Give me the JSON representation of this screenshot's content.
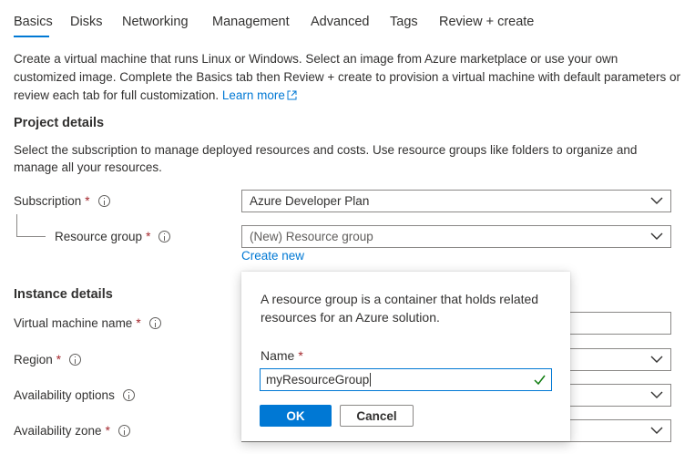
{
  "tabs": [
    {
      "label": "Basics"
    },
    {
      "label": "Disks"
    },
    {
      "label": "Networking"
    },
    {
      "label": "Management"
    },
    {
      "label": "Advanced"
    },
    {
      "label": "Tags"
    },
    {
      "label": "Review + create"
    }
  ],
  "intro": {
    "text": "Create a virtual machine that runs Linux or Windows. Select an image from Azure marketplace or use your own customized image. Complete the Basics tab then Review + create to provision a virtual machine with default parameters or review each tab for full customization.",
    "learn_more": "Learn more"
  },
  "project_details": {
    "title": "Project details",
    "description": "Select the subscription to manage deployed resources and costs. Use resource groups like folders to organize and manage all your resources.",
    "subscription_label": "Subscription",
    "subscription_value": "Azure Developer Plan",
    "resource_group_label": "Resource group",
    "resource_group_value": "(New) Resource group",
    "create_new": "Create new"
  },
  "instance_details": {
    "title": "Instance details",
    "vm_name_label": "Virtual machine name",
    "region_label": "Region",
    "availability_options_label": "Availability options",
    "availability_zone_label": "Availability zone"
  },
  "required_marker": "*",
  "popup": {
    "text": "A resource group is a container that holds related resources for an Azure solution.",
    "name_label": "Name",
    "name_value": "myResourceGroup",
    "ok": "OK",
    "cancel": "Cancel"
  },
  "colors": {
    "accent": "#0078d4",
    "required": "#a4262c",
    "valid": "#107c10"
  }
}
